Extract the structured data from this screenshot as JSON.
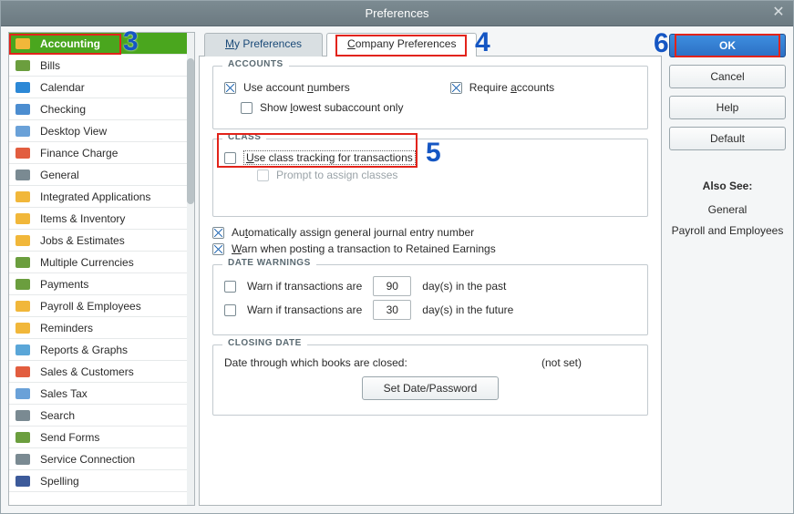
{
  "window": {
    "title": "Preferences"
  },
  "sidebar": {
    "items": [
      {
        "label": "Accounting",
        "selected": true
      },
      {
        "label": "Bills"
      },
      {
        "label": "Calendar"
      },
      {
        "label": "Checking"
      },
      {
        "label": "Desktop View"
      },
      {
        "label": "Finance Charge"
      },
      {
        "label": "General"
      },
      {
        "label": "Integrated Applications"
      },
      {
        "label": "Items & Inventory"
      },
      {
        "label": "Jobs & Estimates"
      },
      {
        "label": "Multiple Currencies"
      },
      {
        "label": "Payments"
      },
      {
        "label": "Payroll & Employees"
      },
      {
        "label": "Reminders"
      },
      {
        "label": "Reports & Graphs"
      },
      {
        "label": "Sales & Customers"
      },
      {
        "label": "Sales Tax"
      },
      {
        "label": "Search"
      },
      {
        "label": "Send Forms"
      },
      {
        "label": "Service Connection"
      },
      {
        "label": "Spelling"
      }
    ]
  },
  "tabs": {
    "my": "My Preferences",
    "company": "Company Preferences",
    "active": "company"
  },
  "accounts": {
    "title": "ACCOUNTS",
    "use_numbers": {
      "label": "Use account numbers",
      "checked": true
    },
    "require": {
      "label": "Require accounts",
      "checked": true
    },
    "show_lowest": {
      "label": "Show lowest subaccount only",
      "checked": false
    }
  },
  "class": {
    "title": "CLASS",
    "use_tracking": {
      "label": "Use class tracking for transactions",
      "checked": false
    },
    "prompt": {
      "label": "Prompt to assign classes",
      "checked": false,
      "disabled": true
    }
  },
  "journal": {
    "auto_assign": {
      "label": "Automatically assign general journal entry number",
      "checked": true
    },
    "warn_retained": {
      "label": "Warn when posting a transaction to Retained Earnings",
      "checked": true
    }
  },
  "date_warnings": {
    "title": "DATE WARNINGS",
    "past": {
      "label_before": "Warn if transactions are",
      "value": "90",
      "label_after": "day(s) in the past",
      "checked": false
    },
    "future": {
      "label_before": "Warn if transactions are",
      "value": "30",
      "label_after": "day(s) in the future",
      "checked": false
    }
  },
  "closing": {
    "title": "CLOSING DATE",
    "label": "Date through which books are closed:",
    "value": "(not set)",
    "button": "Set Date/Password"
  },
  "buttons": {
    "ok": "OK",
    "cancel": "Cancel",
    "help": "Help",
    "default": "Default"
  },
  "also_see": {
    "title": "Also See:",
    "items": [
      "General",
      "Payroll and Employees"
    ]
  },
  "callouts": {
    "c3": "3",
    "c4": "4",
    "c5": "5",
    "c6": "6"
  }
}
